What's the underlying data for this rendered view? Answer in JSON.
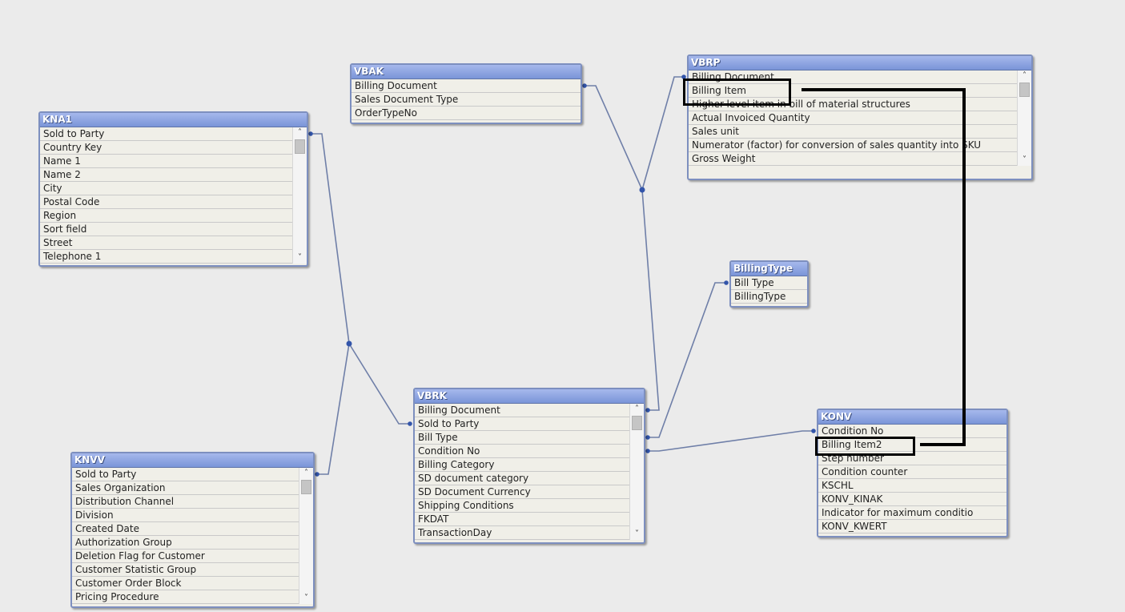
{
  "tables": {
    "kna1": {
      "name": "KNA1",
      "fields": [
        "Sold to Party",
        "Country Key",
        "Name 1",
        "Name 2",
        "City",
        "Postal Code",
        "Region",
        "Sort field",
        "Street",
        "Telephone 1"
      ]
    },
    "knvv": {
      "name": "KNVV",
      "fields": [
        "Sold to Party",
        "Sales Organization",
        "Distribution Channel",
        "Division",
        "Created Date",
        "Authorization Group",
        "Deletion Flag for Customer",
        "Customer Statistic Group",
        "Customer Order Block",
        "Pricing Procedure"
      ]
    },
    "vbak": {
      "name": "VBAK",
      "fields": [
        "Billing Document",
        "Sales Document Type",
        "OrderTypeNo"
      ]
    },
    "vbrp": {
      "name": "VBRP",
      "fields": [
        "Billing Document",
        "Billing Item",
        "Higher-level item in bill of material structures",
        "Actual Invoiced Quantity",
        "Sales unit",
        "Numerator (factor) for conversion of sales quantity into SKU",
        "Gross Weight"
      ]
    },
    "billingtype": {
      "name": "BillingType",
      "fields": [
        "Bill Type",
        "BillingType"
      ]
    },
    "vbrk": {
      "name": "VBRK",
      "fields": [
        "Billing Document",
        "Sold to Party",
        "Bill Type",
        "Condition No",
        "Billing Category",
        "SD document category",
        "SD Document Currency",
        "Shipping Conditions",
        "FKDAT",
        "TransactionDay"
      ]
    },
    "konv": {
      "name": "KONV",
      "fields": [
        "Condition No",
        "Billing Item2",
        "Step number",
        "Condition counter",
        "KSCHL",
        "KONV_KINAK",
        "Indicator for maximum conditio",
        "KONV_KWERT"
      ]
    }
  },
  "scrollbar": {
    "up_arrow": "˄",
    "down_arrow": "˅"
  },
  "colors": {
    "link_line": "#6f7fa8",
    "link_dot": "#3355aa",
    "annotation": "#000000",
    "header": "#7a95d8"
  }
}
